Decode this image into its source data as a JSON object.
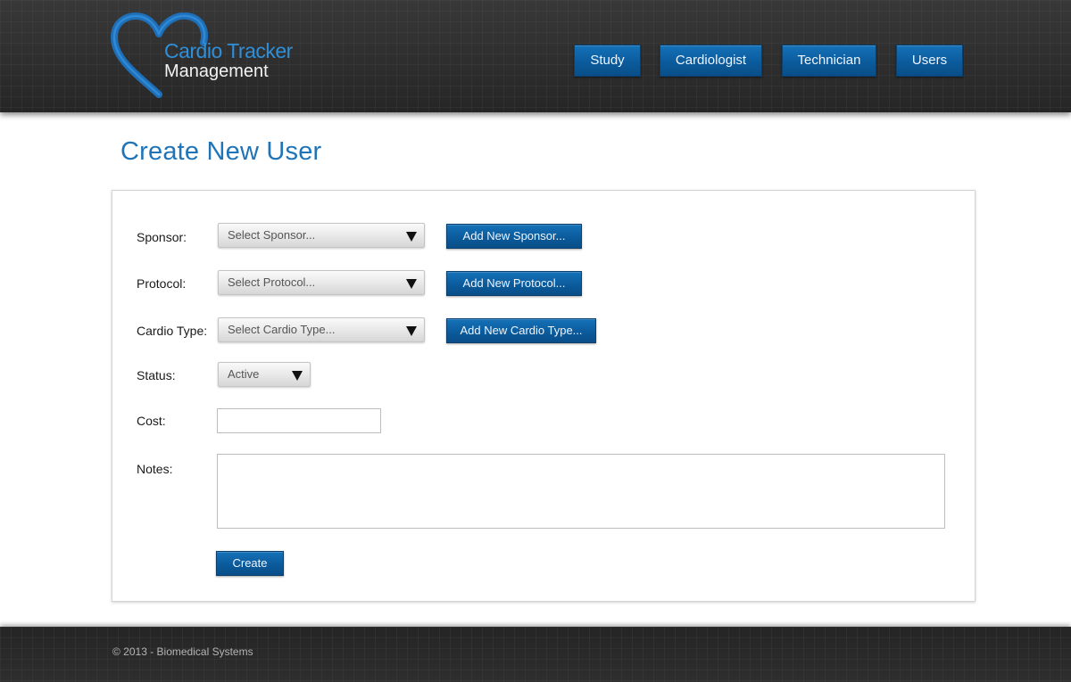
{
  "brand": {
    "name": "Cardio Tracker",
    "subtitle": "Management",
    "icon": "heart-icon",
    "color": "#1e6fb8"
  },
  "nav": {
    "items": [
      {
        "label": "Study"
      },
      {
        "label": "Cardiologist"
      },
      {
        "label": "Technician"
      },
      {
        "label": "Users"
      }
    ]
  },
  "page": {
    "title": "Create New User"
  },
  "form": {
    "sponsor": {
      "label": "Sponsor:",
      "selected": "Select Sponsor...",
      "add_label": "Add New Sponsor..."
    },
    "protocol": {
      "label": "Protocol:",
      "selected": "Select Protocol...",
      "add_label": "Add New Protocol..."
    },
    "cardio_type": {
      "label": "Cardio Type:",
      "selected": "Select Cardio Type...",
      "add_label": "Add New Cardio Type..."
    },
    "status": {
      "label": "Status:",
      "selected": "Active"
    },
    "cost": {
      "label": "Cost:",
      "value": ""
    },
    "notes": {
      "label": "Notes:",
      "value": ""
    },
    "submit_label": "Create"
  },
  "footer": {
    "text": "© 2013 - Biomedical Systems"
  },
  "colors": {
    "accent": "#0b5b9c",
    "header_bg": "#2b2b2b",
    "title": "#1f74b8"
  }
}
